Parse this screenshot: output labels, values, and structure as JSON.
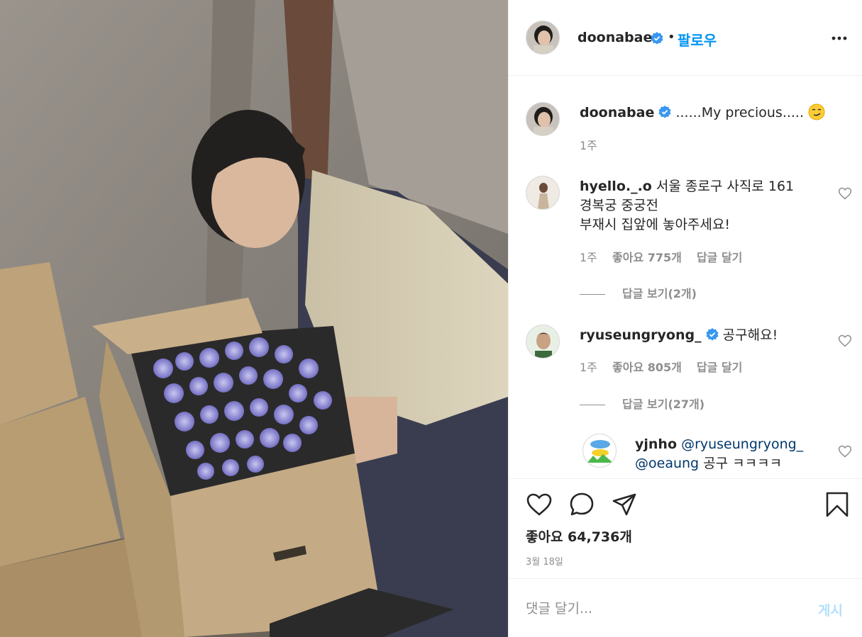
{
  "post": {
    "author": "doonabae",
    "follow_label": "팔로우",
    "dot": "•",
    "caption": {
      "username": "doonabae",
      "text": "......My precious.....",
      "time": "1주"
    },
    "image_description": "photo-of-woman-with-box-of-flowers"
  },
  "comments": [
    {
      "username": "hyello._.o",
      "text_line1": "서울 종로구 사직로 161",
      "text_line2": "경복궁 중궁전",
      "text_line3": "부재시 집앞에 놓아주세요!",
      "time": "1주",
      "likes": "좋아요 775개",
      "reply": "답글 달기",
      "view_replies": "답글 보기(2개)"
    },
    {
      "username": "ryuseungryong_",
      "text": "공구해요!",
      "time": "1주",
      "likes": "좋아요 805개",
      "reply": "답글 달기",
      "view_replies": "답글 보기(27개)"
    },
    {
      "username": "yjnho",
      "mention1": "@ryuseungryong_",
      "mention2": "@oeaung",
      "text": "공구 ㅋㅋㅋㅋ"
    }
  ],
  "actions": {
    "likes": "좋아요 64,736개",
    "date": "3월 18일"
  },
  "add_comment": {
    "placeholder": "댓글 달기...",
    "post_label": "게시"
  },
  "colors": {
    "accent": "#0095f6",
    "verified": "#3897f0",
    "muted": "#8e8e8e"
  }
}
